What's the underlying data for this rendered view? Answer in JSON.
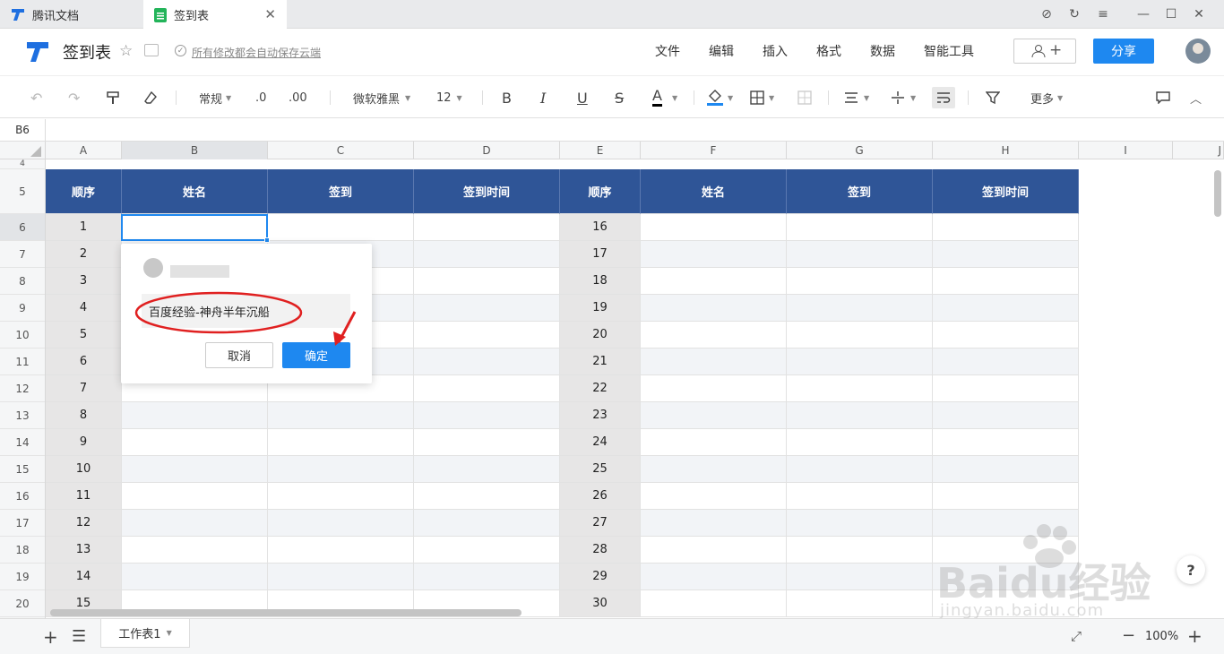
{
  "tabs": [
    {
      "label": "腾讯文档"
    },
    {
      "label": "签到表"
    }
  ],
  "window": {
    "compass": "⊘",
    "refresh": "↻",
    "menu": "≡",
    "min": "—",
    "max": "☐",
    "close": "✕"
  },
  "header": {
    "title": "签到表",
    "autosave": "所有修改都会自动保存云端",
    "menus": [
      "文件",
      "编辑",
      "插入",
      "格式",
      "数据",
      "智能工具"
    ],
    "share": "分享",
    "invite": "+"
  },
  "toolbar": {
    "format": "常规",
    "dec_dec": ".0",
    "inc_dec": ".00",
    "font": "微软雅黑",
    "size": "12",
    "bold": "B",
    "italic": "I",
    "underline": "U",
    "strike": "S",
    "fontcolor": "A",
    "more": "更多"
  },
  "formula": {
    "cellref": "B6"
  },
  "columns": [
    "A",
    "B",
    "C",
    "D",
    "E",
    "F",
    "G",
    "H",
    "I",
    "J"
  ],
  "rows": [
    "4",
    "5",
    "6",
    "7",
    "8",
    "9",
    "10",
    "11",
    "12",
    "13",
    "14",
    "15",
    "16",
    "17",
    "18",
    "19",
    "20"
  ],
  "table_header": [
    "顺序",
    "姓名",
    "签到",
    "签到时间",
    "顺序",
    "姓名",
    "签到",
    "签到时间"
  ],
  "left_numbers": [
    "1",
    "2",
    "3",
    "4",
    "5",
    "6",
    "7",
    "8",
    "9",
    "10",
    "11",
    "12",
    "13",
    "14",
    "15"
  ],
  "right_numbers": [
    "16",
    "17",
    "18",
    "19",
    "20",
    "21",
    "22",
    "23",
    "24",
    "25",
    "26",
    "27",
    "28",
    "29",
    "30"
  ],
  "popup": {
    "input": "百度经验-神舟半年沉船",
    "cancel": "取消",
    "ok": "确定"
  },
  "bottom": {
    "sheet": "工作表1",
    "zoom": "100%"
  },
  "watermark": {
    "text": "Baidu经验",
    "url": "jingyan.baidu.com"
  },
  "colors": {
    "header_bg": "#2f5597",
    "accent": "#1e88f0",
    "number_bg": "#e7e6e6",
    "annotation": "#e02020"
  }
}
